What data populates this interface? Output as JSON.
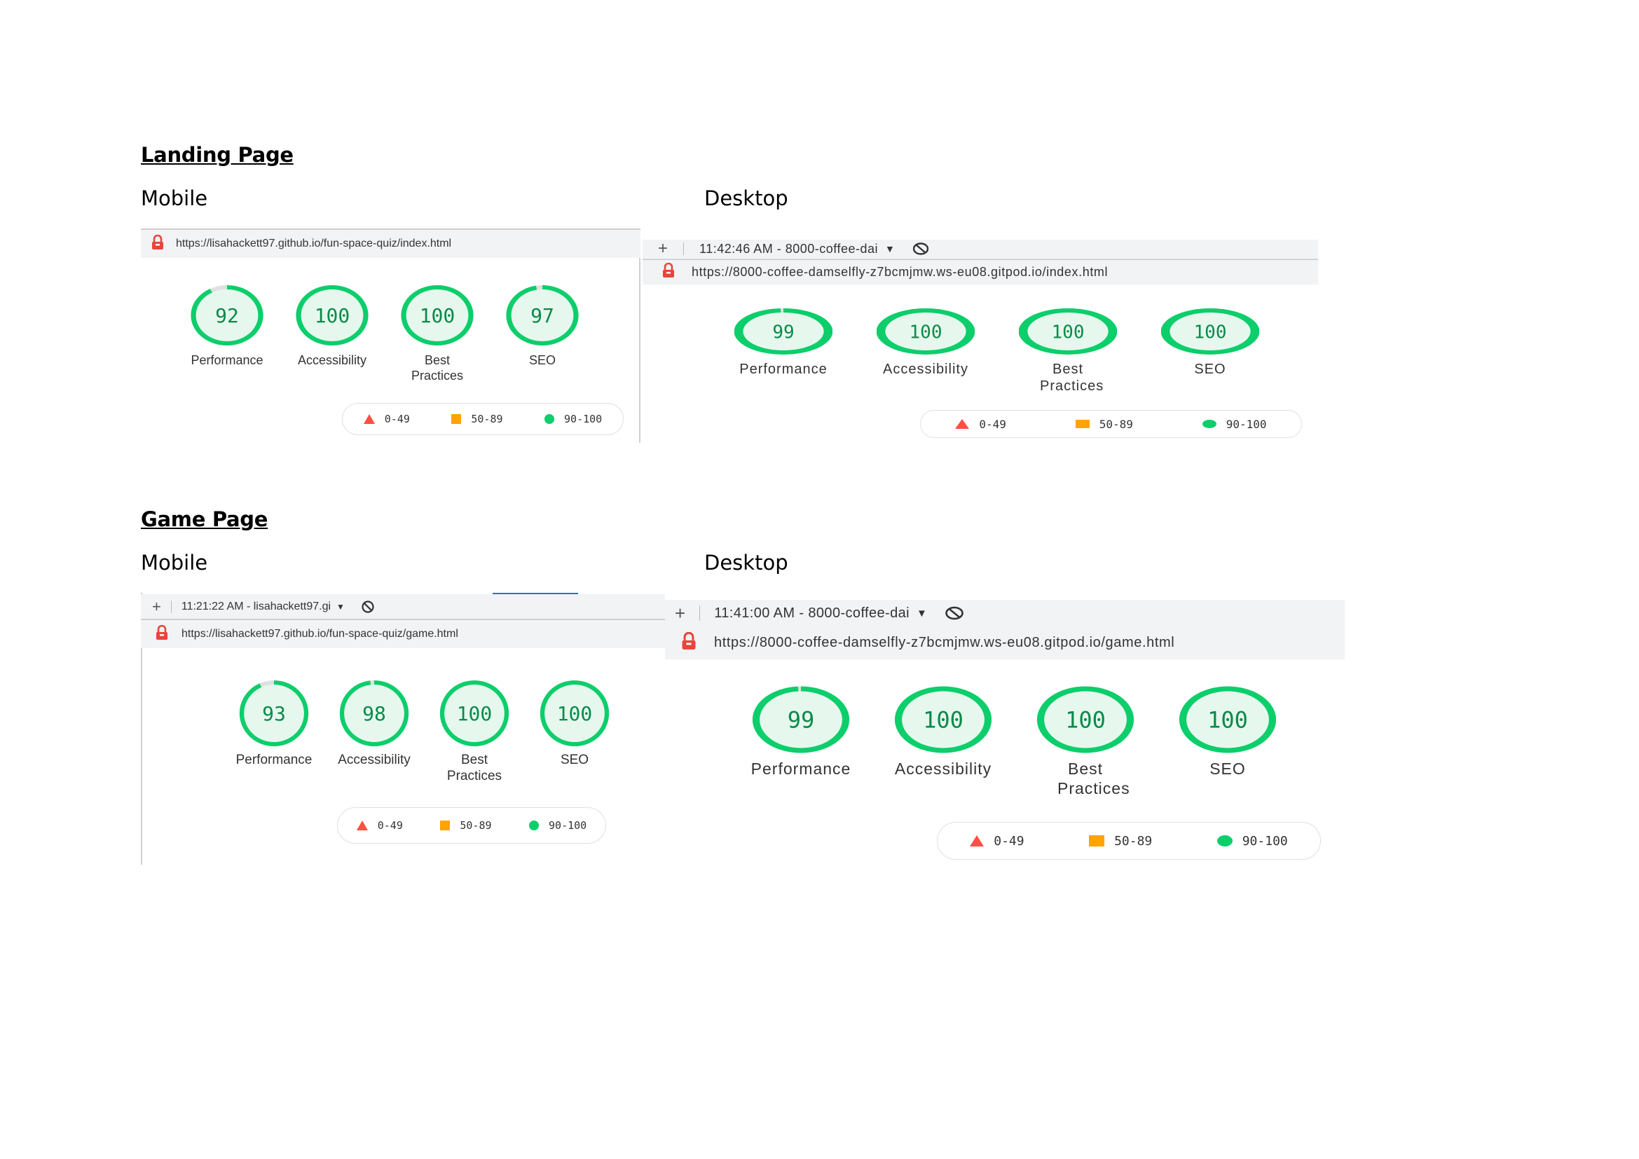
{
  "sections": {
    "landing": {
      "title": "Landing Page",
      "mobile_label": "Mobile",
      "desktop_label": "Desktop"
    },
    "game": {
      "title": "Game Page",
      "mobile_label": "Mobile",
      "desktop_label": "Desktop"
    }
  },
  "reports": {
    "landing_mobile": {
      "url": "https://lisahackett97.github.io/fun-space-quiz/index.html",
      "scores": [
        {
          "value": "92",
          "label": "Performance"
        },
        {
          "value": "100",
          "label": "Accessibility"
        },
        {
          "value": "100",
          "label": "Best Practices"
        },
        {
          "value": "97",
          "label": "SEO"
        }
      ]
    },
    "landing_desktop": {
      "tab": "11:42:46 AM - 8000-coffee-dai",
      "url": "https://8000-coffee-damselfly-z7bcmjmw.ws-eu08.gitpod.io/index.html",
      "scores": [
        {
          "value": "99",
          "label": "Performance"
        },
        {
          "value": "100",
          "label": "Accessibility"
        },
        {
          "value": "100",
          "label": "Best Practices"
        },
        {
          "value": "100",
          "label": "SEO"
        }
      ]
    },
    "game_mobile": {
      "tab": "11:21:22 AM - lisahackett97.gi",
      "url": "https://lisahackett97.github.io/fun-space-quiz/game.html",
      "scores": [
        {
          "value": "93",
          "label": "Performance"
        },
        {
          "value": "98",
          "label": "Accessibility"
        },
        {
          "value": "100",
          "label": "Best Practices"
        },
        {
          "value": "100",
          "label": "SEO"
        }
      ]
    },
    "game_desktop": {
      "tab": "11:41:00 AM - 8000-coffee-dai",
      "url": "https://8000-coffee-damselfly-z7bcmjmw.ws-eu08.gitpod.io/game.html",
      "scores": [
        {
          "value": "99",
          "label": "Performance"
        },
        {
          "value": "100",
          "label": "Accessibility"
        },
        {
          "value": "100",
          "label": "Best Practices"
        },
        {
          "value": "100",
          "label": "SEO"
        }
      ]
    }
  },
  "legend": {
    "low": "0-49",
    "mid": "50-89",
    "high": "90-100"
  },
  "colors": {
    "pass": "#0cce6b",
    "pass_fill": "#e6f8ee",
    "average": "#ffa400",
    "fail": "#ff4e42",
    "lock": "#e8453c"
  },
  "icons": {
    "new_tab": "plus-icon",
    "dropdown": "caret-down-icon",
    "blocked": "no-entry-icon",
    "secure": "lock-icon"
  }
}
